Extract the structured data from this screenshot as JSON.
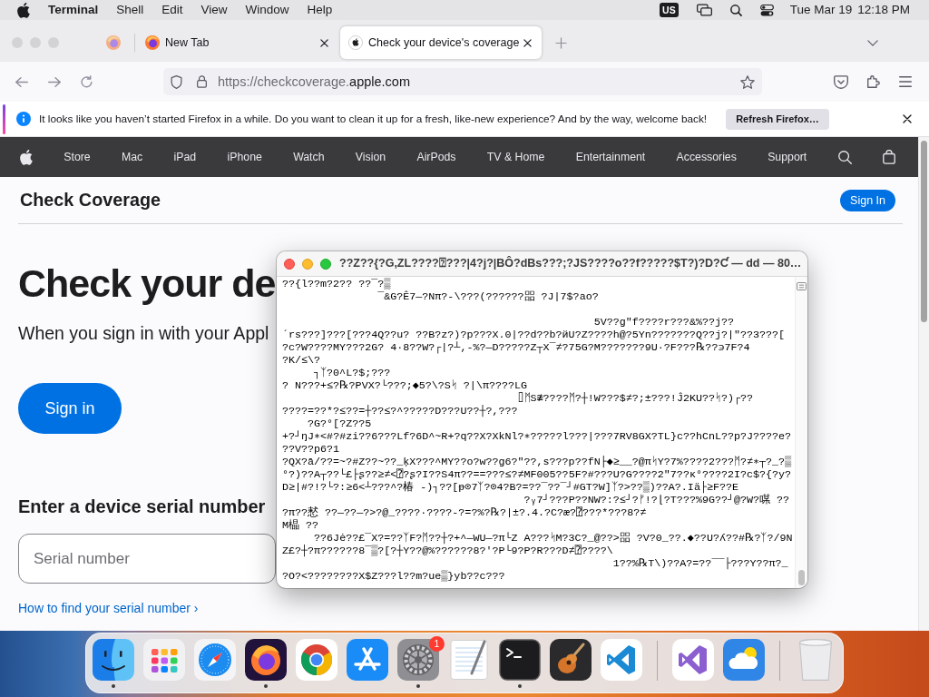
{
  "menubar": {
    "app_name": "Terminal",
    "menus": [
      "Shell",
      "Edit",
      "View",
      "Window",
      "Help"
    ],
    "input_source": "US",
    "date": "Tue Mar 19",
    "time": "12:18 PM"
  },
  "browser": {
    "tabs": [
      {
        "kind": "pinned",
        "selected": false
      },
      {
        "kind": "browser",
        "label": "New Tab",
        "selected": false
      },
      {
        "kind": "site",
        "label": "Check your device's coverage",
        "selected": true
      }
    ],
    "address_bar": {
      "url_prefix": "https://checkcoverage.",
      "url_domain": "apple.com"
    },
    "notification": {
      "message": "It looks like you haven’t started Firefox in a while. Do you want to clean it up for a fresh, like-new experience? And by the way, welcome back!",
      "button": "Refresh Firefox…"
    }
  },
  "page": {
    "nav_items": [
      "Store",
      "Mac",
      "iPad",
      "iPhone",
      "Watch",
      "Vision",
      "AirPods",
      "TV & Home",
      "Entertainment",
      "Accessories",
      "Support"
    ],
    "header": {
      "title": "Check Coverage",
      "button": "Sign In"
    },
    "hero": {
      "heading": "Check your de",
      "subtitle": "When you sign in with your Appl",
      "button": "Sign in"
    },
    "serial": {
      "heading": "Enter a device serial number",
      "placeholder": "Serial number",
      "help_link": "How to find your serial number ›"
    }
  },
  "terminal": {
    "title": "??Z??{?G,ZL????⍰???|4?j?|BÔ?dBs???;?JS????o??f?????$T?)?D?Ƈ — dd — 80…",
    "output": "??{l??m?2?? ??¯?▒\n               ¯&G?Ê7—?Nπ?-\\???(??????㗊 ?J|7$?ao?\n\n                                                 5V??g\"f????r???&%??j??\n´rs???]???[???4Q??u? ??B?z?)?p???X.0|??d??b?йU?Z????h@?5Yn???????Q??j?|\"??3???[\n?c?W????MY???2G? 4·8??W?┌|?┴,-%?—D?????Z┬X¯≠?75G?M???????9U·?F???℞??϶7F?4\n?K/≤\\?\n     ┐ᛉ?0^L?$;???\n? N???+≤?℞?PVX?└???;◆5?\\?Sᛋ ?|\\π????LG\n                                     ⌷ᛗS≇????ᛗ?┼!W???$≠?;±???!Ĵ2KU??ᛋ?)┌??\n????=??*?≤??=┼??≤?^?????D???U??┼?,???\n    ?G?°[?Z??5\n+?┘ŋJ∗<#?#zi??6???Lf?6D^~R+?q??X?XkNl?∗?????l???|???7RV8GX?TL}c??hCnL??p?J????e?\n??V??p6?1\n?QX?ā/??=~?#Z??~??_ķX???^MY??o?w??g6?\"??,s???p??fN├◆≥__?@πᛋY?7%????2???ᛗ?≠∗┬?_?▒\n°?)??A┬??└£├ʂ??≥≠<⍰?ʂ?I??S4π??==???≤?≠MF005??5F?#???U?G????2\"7??κ°????2I?c$?{?y?\nD≥|#?!?└?:≥6<┴???^?椿 -)┐??[ᵽ⊙7ᛉ?⊙4?B?=??¯??¯┘#GT?W]ᛉ?>??▒)??A?.Iä├≥F??E\n                                      ?ᵧ7┘???P??NW?:?≤┘?ᚠ!?⌊?T???%9G??┘@?W?㖼 ??\n?π??慭 ??—??—?>?@_????·????-?=?%?℞?|±?.4.?C?æ?⍰???*???8?≠\nM橸 ??\n     ??6Jė??£¯X?=??ᛉF?ᛗ??┼?+^—WU—?π└Z A???ᛋM?3C?_@??>㗊 ?V?0_??.◆??U?ʎ??#℞?ᛉ?/9N\nZ£?┼?π??????8¯▒?[?┼Y??@%??????8?'?P└9?P?R???D≠⍰????\\\n                                                    1??%℞T\\)??A?=??¯¯├???Y??π?_\n?O?<????????X$Z???l??m?ue▒}yb??c???"
  },
  "dock": {
    "sections": [
      {
        "items": [
          {
            "kind": "face",
            "running": true
          },
          {
            "kind": "grid",
            "running": false
          },
          {
            "kind": "compass",
            "running": false
          },
          {
            "kind": "flame",
            "running": true
          },
          {
            "kind": "chroma",
            "running": false
          },
          {
            "kind": "sticks",
            "running": false
          },
          {
            "kind": "gear",
            "running": true,
            "badge": "1"
          },
          {
            "kind": "notepad",
            "running": false
          },
          {
            "kind": "prompt",
            "running": true
          },
          {
            "kind": "guitar",
            "running": false
          },
          {
            "kind": "ribbon",
            "running": false
          }
        ]
      },
      {
        "items": [
          {
            "kind": "loop",
            "running": false
          },
          {
            "kind": "weather",
            "running": false
          }
        ]
      },
      {
        "items": [
          {
            "kind": "bin",
            "running": false
          }
        ]
      }
    ]
  }
}
